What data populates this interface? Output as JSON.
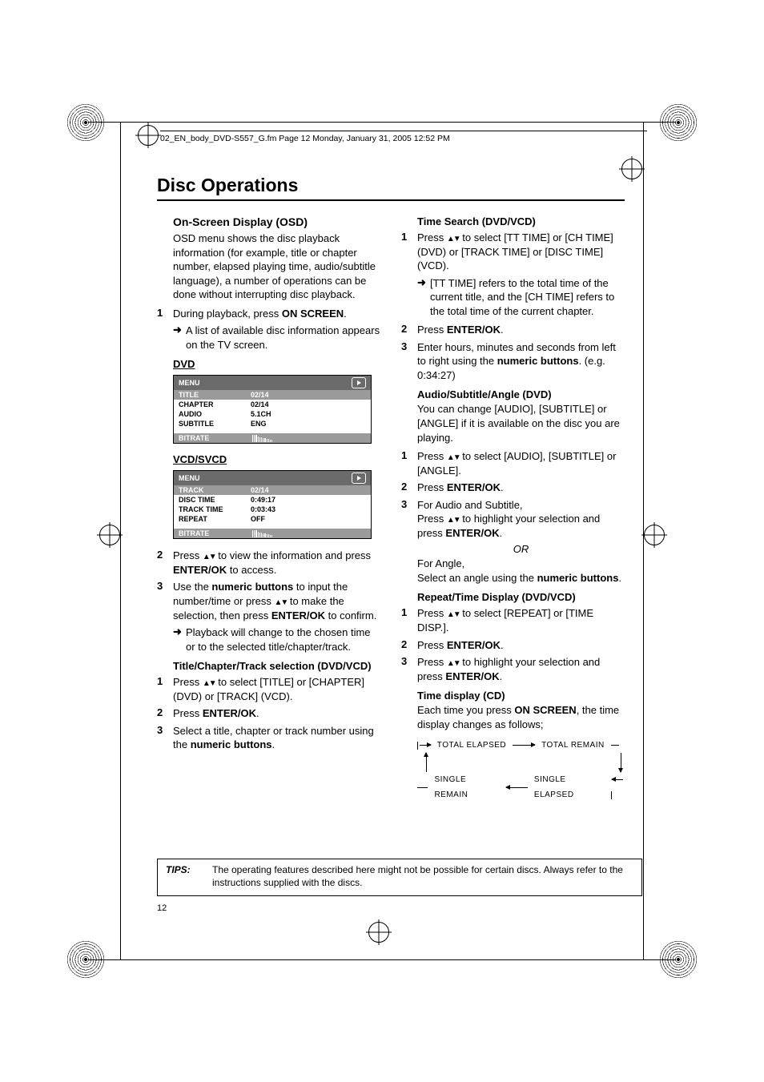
{
  "header_line": "02_EN_body_DVD-S557_G.fm  Page 12  Monday, January 31, 2005  12:52 PM",
  "page_title": "Disc Operations",
  "page_number": "12",
  "left": {
    "osd_heading": "On-Screen Display (OSD)",
    "osd_intro": "OSD menu shows the disc playback information (for example, title or chapter number, elapsed playing time, audio/subtitle language), a number of operations can be done without interrupting disc playback.",
    "step1_a": "During playback, press ",
    "step1_b": "ON SCREEN",
    "step1_c": ".",
    "arrow1": "A list of available disc information appears on the TV screen.",
    "dvd_label": "DVD",
    "dvd_menu": "MENU",
    "dvd_rows": [
      {
        "lab": "TITLE",
        "val": "02/14"
      },
      {
        "lab": "CHAPTER",
        "val": "02/14"
      },
      {
        "lab": "AUDIO",
        "val": "5.1CH"
      },
      {
        "lab": "SUBTITLE",
        "val": "ENG"
      }
    ],
    "dvd_bitrate": "BITRATE",
    "vcd_label": "VCD/SVCD",
    "vcd_menu": "MENU",
    "vcd_rows": [
      {
        "lab": "TRACK",
        "val": "02/14"
      },
      {
        "lab": "DISC TIME",
        "val": "0:49:17"
      },
      {
        "lab": "TRACK TIME",
        "val": "0:03:43"
      },
      {
        "lab": "REPEAT",
        "val": "OFF"
      }
    ],
    "vcd_bitrate": "BITRATE",
    "step2_a": "Press ",
    "step2_b": " to view the information and press ",
    "step2_c": "ENTER/OK",
    "step2_d": " to access.",
    "step3_a": "Use the ",
    "step3_b": "numeric buttons",
    "step3_c": " to input the number/time or press ",
    "step3_d": " to make the selection, then press ",
    "step3_e": "ENTER/OK",
    "step3_f": " to confirm.",
    "arrow3": "Playback will change to the chosen time or to the selected title/chapter/track.",
    "tct_heading": "Title/Chapter/Track selection (DVD/VCD)",
    "tct1_a": "Press ",
    "tct1_b": " to select [TITLE] or [CHAPTER] (DVD) or [TRACK] (VCD).",
    "tct2_a": "Press ",
    "tct2_b": "ENTER/OK",
    "tct2_c": ".",
    "tct3_a": "Select a title, chapter or track number using the ",
    "tct3_b": "numeric buttons",
    "tct3_c": "."
  },
  "right": {
    "ts_heading": "Time Search (DVD/VCD)",
    "ts1_a": "Press ",
    "ts1_b": " to select [TT TIME] or [CH TIME] (DVD) or [TRACK TIME] or [DISC TIME] (VCD).",
    "ts_arrow": "[TT TIME] refers to the total time of the current title, and the [CH TIME] refers to the total time of the current chapter.",
    "ts2_a": "Press ",
    "ts2_b": "ENTER/OK",
    "ts2_c": ".",
    "ts3_a": "Enter hours, minutes and seconds from left to right using the ",
    "ts3_b": "numeric buttons",
    "ts3_c": ". (e.g. 0:34:27)",
    "asa_heading": "Audio/Subtitle/Angle (DVD)",
    "asa_intro": "You can change [AUDIO], [SUBTITLE] or [ANGLE] if it is available on the disc you are playing.",
    "asa1_a": "Press ",
    "asa1_b": " to select [AUDIO], [SUBTITLE] or [ANGLE].",
    "asa2_a": "Press ",
    "asa2_b": "ENTER/OK",
    "asa2_c": ".",
    "asa3_a": "For Audio and Subtitle,",
    "asa3_b": "Press ",
    "asa3_c": " to highlight your selection and press ",
    "asa3_d": "ENTER/OK",
    "asa3_e": ".",
    "or": "OR",
    "asa3_f": "For Angle,",
    "asa3_g": "Select an angle using the ",
    "asa3_h": "numeric buttons",
    "asa3_i": ".",
    "rt_heading": "Repeat/Time Display (DVD/VCD)",
    "rt1_a": "Press ",
    "rt1_b": " to select [REPEAT] or [TIME DISP.].",
    "rt2_a": "Press ",
    "rt2_b": "ENTER/OK",
    "rt2_c": ".",
    "rt3_a": "Press ",
    "rt3_b": " to highlight your selection and press ",
    "rt3_c": "ENTER/OK",
    "rt3_d": ".",
    "td_heading": "Time display (CD)",
    "td_intro_a": "Each time you press ",
    "td_intro_b": "ON SCREEN",
    "td_intro_c": ", the time display changes as follows;",
    "cycle": {
      "a": "TOTAL ELAPSED",
      "b": "TOTAL REMAIN",
      "c": "SINGLE ELAPSED",
      "d": "SINGLE REMAIN"
    }
  },
  "tips_label": "TIPS:",
  "tips_text": "The operating features described here might not be possible for certain discs. Always refer to the instructions supplied with the discs.",
  "arrows_ud": "▲▼"
}
